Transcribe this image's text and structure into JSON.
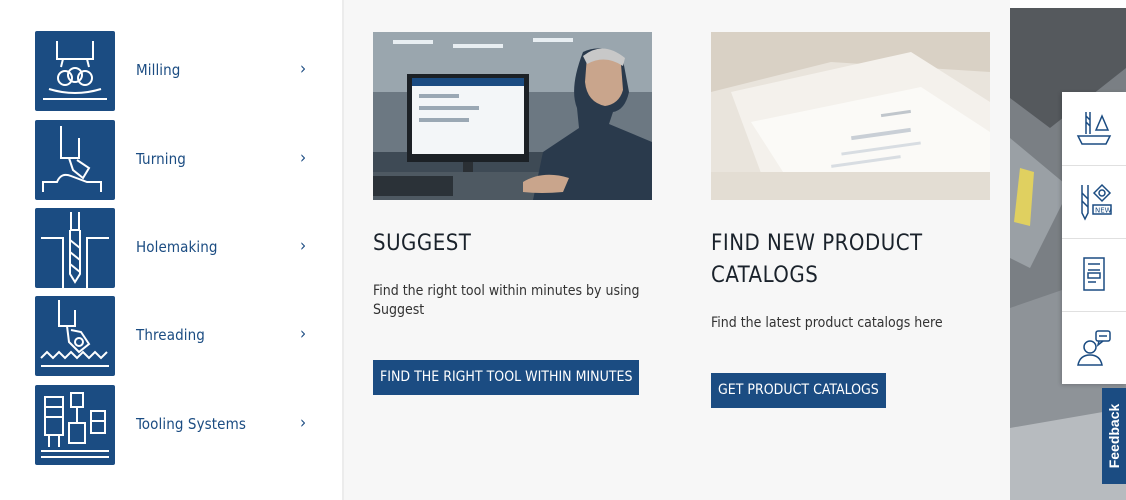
{
  "categories": [
    {
      "label": "Milling",
      "icon": "milling-icon"
    },
    {
      "label": "Turning",
      "icon": "turning-icon"
    },
    {
      "label": "Holemaking",
      "icon": "holemaking-icon"
    },
    {
      "label": "Threading",
      "icon": "threading-icon"
    },
    {
      "label": "Tooling Systems",
      "icon": "tooling-systems-icon"
    }
  ],
  "chevron": "›",
  "cards": {
    "suggest": {
      "title": "SUGGEST",
      "text": "Find the right tool within minutes by using Suggest",
      "button": "FIND THE RIGHT TOOL WITHIN MINUTES"
    },
    "catalogs": {
      "title": "FIND NEW PRODUCT CATALOGS",
      "text": "Find the latest product catalogs here",
      "button": "GET PRODUCT CATALOGS"
    }
  },
  "side_tabs": [
    "product-configurator-icon",
    "new-products-icon",
    "catalog-icon",
    "contact-expert-icon"
  ],
  "feedback": "Feedback",
  "colors": {
    "brand_blue": "#1b4c82",
    "panel_bg": "#f7f7f7"
  }
}
